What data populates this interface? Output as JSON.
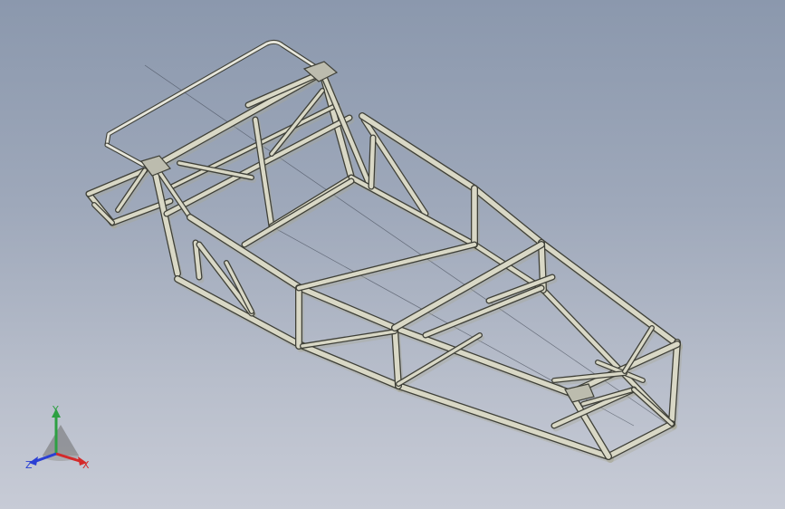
{
  "viewport": {
    "model_name": "space-frame-chassis",
    "colors": {
      "tube_face": "#d9d8c6",
      "tube_edge": "#3f4038",
      "tube_shade": "#a9a894",
      "gusset": "#bcbcae",
      "centerline": "#2e3440"
    }
  },
  "triad": {
    "x_label": "X",
    "y_label": "Y",
    "z_label": "Z",
    "x_color": "#d42a2a",
    "y_color": "#2ea043",
    "z_color": "#2a3fd4"
  }
}
